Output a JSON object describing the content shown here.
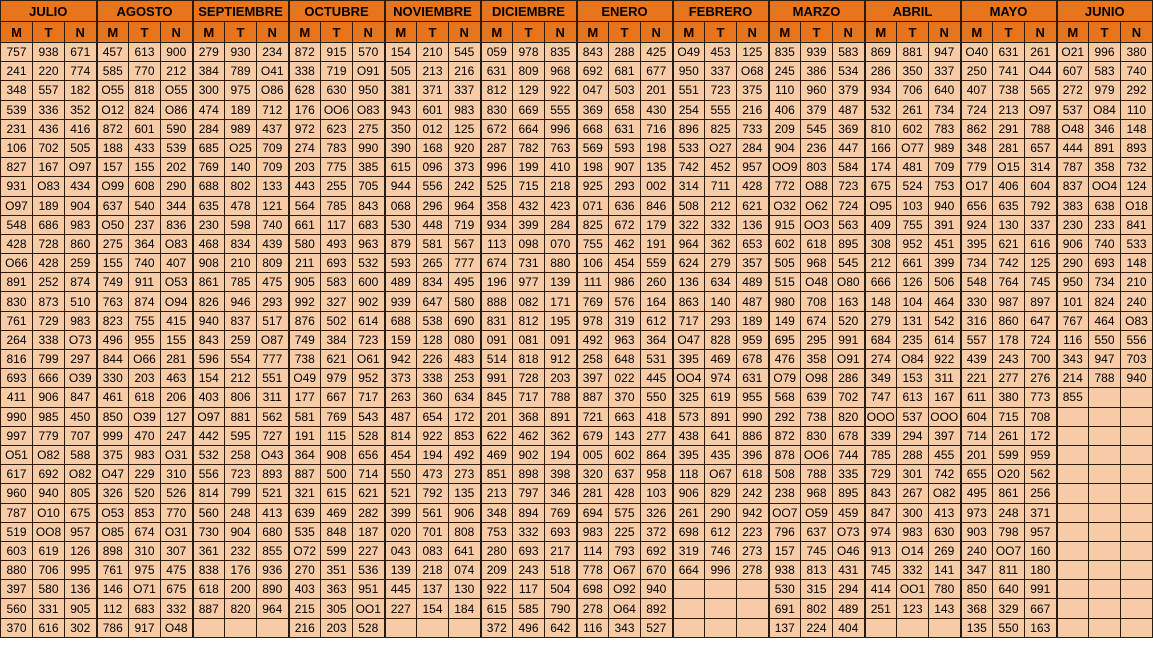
{
  "months": [
    "JULIO",
    "AGOSTO",
    "SEPTIEMBRE",
    "OCTUBRE",
    "NOVIEMBRE",
    "DICIEMBRE",
    "ENERO",
    "FEBRERO",
    "MARZO",
    "ABRIL",
    "MAYO",
    "JUNIO"
  ],
  "subheaders": [
    "M",
    "T",
    "N"
  ],
  "rows": [
    [
      "757",
      "938",
      "671",
      "457",
      "613",
      "900",
      "279",
      "930",
      "234",
      "872",
      "915",
      "570",
      "154",
      "210",
      "545",
      "059",
      "978",
      "835",
      "843",
      "288",
      "425",
      "O49",
      "453",
      "125",
      "835",
      "939",
      "583",
      "869",
      "881",
      "947",
      "O40",
      "631",
      "261",
      "O21",
      "996",
      "380"
    ],
    [
      "241",
      "220",
      "774",
      "585",
      "770",
      "212",
      "384",
      "789",
      "O41",
      "338",
      "719",
      "O91",
      "505",
      "213",
      "216",
      "631",
      "809",
      "968",
      "692",
      "681",
      "677",
      "950",
      "337",
      "O68",
      "245",
      "386",
      "534",
      "286",
      "350",
      "337",
      "250",
      "741",
      "O44",
      "607",
      "583",
      "740"
    ],
    [
      "348",
      "557",
      "182",
      "O55",
      "818",
      "O55",
      "300",
      "975",
      "O86",
      "628",
      "630",
      "950",
      "381",
      "371",
      "337",
      "812",
      "129",
      "922",
      "047",
      "503",
      "201",
      "551",
      "723",
      "375",
      "110",
      "960",
      "379",
      "934",
      "706",
      "640",
      "407",
      "738",
      "565",
      "272",
      "979",
      "292"
    ],
    [
      "539",
      "336",
      "352",
      "O12",
      "824",
      "O86",
      "474",
      "189",
      "712",
      "176",
      "OO6",
      "O83",
      "943",
      "601",
      "983",
      "830",
      "669",
      "555",
      "369",
      "658",
      "430",
      "254",
      "555",
      "216",
      "406",
      "379",
      "487",
      "532",
      "261",
      "734",
      "724",
      "213",
      "O97",
      "537",
      "O84",
      "110"
    ],
    [
      "231",
      "436",
      "416",
      "872",
      "601",
      "590",
      "284",
      "989",
      "437",
      "972",
      "623",
      "275",
      "350",
      "012",
      "125",
      "672",
      "664",
      "996",
      "668",
      "631",
      "716",
      "896",
      "825",
      "733",
      "209",
      "545",
      "369",
      "810",
      "602",
      "783",
      "862",
      "291",
      "788",
      "O48",
      "346",
      "148"
    ],
    [
      "106",
      "702",
      "505",
      "188",
      "433",
      "539",
      "685",
      "O25",
      "709",
      "274",
      "783",
      "990",
      "390",
      "168",
      "920",
      "287",
      "782",
      "763",
      "569",
      "593",
      "198",
      "533",
      "O27",
      "284",
      "904",
      "236",
      "447",
      "166",
      "O77",
      "989",
      "348",
      "281",
      "657",
      "444",
      "891",
      "893"
    ],
    [
      "827",
      "167",
      "O97",
      "157",
      "155",
      "202",
      "769",
      "140",
      "709",
      "203",
      "775",
      "385",
      "615",
      "096",
      "373",
      "996",
      "199",
      "410",
      "198",
      "907",
      "135",
      "742",
      "452",
      "957",
      "OO9",
      "803",
      "584",
      "174",
      "481",
      "709",
      "779",
      "O15",
      "314",
      "787",
      "358",
      "732"
    ],
    [
      "931",
      "O83",
      "434",
      "O99",
      "608",
      "290",
      "688",
      "802",
      "133",
      "443",
      "255",
      "705",
      "944",
      "556",
      "242",
      "525",
      "715",
      "218",
      "925",
      "293",
      "002",
      "314",
      "711",
      "428",
      "772",
      "O88",
      "723",
      "675",
      "524",
      "753",
      "O17",
      "406",
      "604",
      "837",
      "OO4",
      "124"
    ],
    [
      "O97",
      "189",
      "904",
      "637",
      "540",
      "344",
      "635",
      "478",
      "121",
      "564",
      "785",
      "843",
      "068",
      "296",
      "964",
      "358",
      "432",
      "423",
      "071",
      "636",
      "846",
      "508",
      "212",
      "621",
      "O32",
      "O62",
      "724",
      "O95",
      "103",
      "940",
      "656",
      "635",
      "792",
      "383",
      "638",
      "O18"
    ],
    [
      "548",
      "686",
      "983",
      "O50",
      "237",
      "836",
      "230",
      "598",
      "740",
      "661",
      "117",
      "683",
      "530",
      "448",
      "719",
      "934",
      "399",
      "284",
      "825",
      "672",
      "179",
      "322",
      "332",
      "136",
      "915",
      "OO3",
      "563",
      "409",
      "755",
      "391",
      "924",
      "130",
      "337",
      "230",
      "233",
      "841"
    ],
    [
      "428",
      "728",
      "860",
      "275",
      "364",
      "O83",
      "468",
      "834",
      "439",
      "580",
      "493",
      "963",
      "879",
      "581",
      "567",
      "113",
      "098",
      "070",
      "755",
      "462",
      "191",
      "964",
      "362",
      "653",
      "602",
      "618",
      "895",
      "308",
      "952",
      "451",
      "395",
      "621",
      "616",
      "906",
      "740",
      "533"
    ],
    [
      "O66",
      "428",
      "259",
      "155",
      "740",
      "407",
      "908",
      "210",
      "809",
      "211",
      "693",
      "532",
      "593",
      "265",
      "777",
      "674",
      "731",
      "880",
      "106",
      "454",
      "559",
      "624",
      "279",
      "357",
      "505",
      "968",
      "545",
      "212",
      "661",
      "399",
      "734",
      "742",
      "125",
      "290",
      "693",
      "148"
    ],
    [
      "891",
      "252",
      "874",
      "749",
      "911",
      "O53",
      "861",
      "785",
      "475",
      "905",
      "583",
      "600",
      "489",
      "834",
      "495",
      "196",
      "977",
      "139",
      "111",
      "986",
      "260",
      "136",
      "634",
      "489",
      "515",
      "O48",
      "O80",
      "666",
      "126",
      "506",
      "548",
      "764",
      "745",
      "950",
      "734",
      "210"
    ],
    [
      "830",
      "873",
      "510",
      "763",
      "874",
      "O94",
      "826",
      "946",
      "293",
      "992",
      "327",
      "902",
      "939",
      "647",
      "580",
      "888",
      "082",
      "171",
      "769",
      "576",
      "164",
      "863",
      "140",
      "487",
      "980",
      "708",
      "163",
      "148",
      "104",
      "464",
      "330",
      "987",
      "897",
      "101",
      "824",
      "240"
    ],
    [
      "761",
      "729",
      "983",
      "823",
      "755",
      "415",
      "940",
      "837",
      "517",
      "876",
      "502",
      "614",
      "688",
      "538",
      "690",
      "831",
      "812",
      "195",
      "978",
      "319",
      "612",
      "717",
      "293",
      "189",
      "149",
      "674",
      "520",
      "279",
      "131",
      "542",
      "316",
      "860",
      "647",
      "767",
      "464",
      "O83"
    ],
    [
      "264",
      "338",
      "O73",
      "496",
      "955",
      "155",
      "843",
      "259",
      "O87",
      "749",
      "384",
      "723",
      "159",
      "128",
      "080",
      "091",
      "081",
      "091",
      "492",
      "963",
      "364",
      "O47",
      "828",
      "959",
      "695",
      "295",
      "991",
      "684",
      "235",
      "614",
      "557",
      "178",
      "724",
      "116",
      "550",
      "556"
    ],
    [
      "816",
      "799",
      "297",
      "844",
      "O66",
      "281",
      "596",
      "554",
      "777",
      "738",
      "621",
      "O61",
      "942",
      "226",
      "483",
      "514",
      "818",
      "912",
      "258",
      "648",
      "531",
      "395",
      "469",
      "678",
      "476",
      "358",
      "O91",
      "274",
      "O84",
      "922",
      "439",
      "243",
      "700",
      "343",
      "947",
      "703"
    ],
    [
      "693",
      "666",
      "O39",
      "330",
      "203",
      "463",
      "154",
      "212",
      "551",
      "O49",
      "979",
      "952",
      "373",
      "338",
      "253",
      "991",
      "728",
      "203",
      "397",
      "022",
      "445",
      "OO4",
      "974",
      "631",
      "O79",
      "O98",
      "286",
      "349",
      "153",
      "311",
      "221",
      "277",
      "276",
      "214",
      "788",
      "940"
    ],
    [
      "411",
      "906",
      "847",
      "461",
      "618",
      "206",
      "403",
      "806",
      "311",
      "177",
      "667",
      "717",
      "263",
      "360",
      "634",
      "845",
      "717",
      "788",
      "887",
      "370",
      "550",
      "325",
      "619",
      "955",
      "568",
      "639",
      "702",
      "747",
      "613",
      "167",
      "611",
      "380",
      "773",
      "855",
      "",
      ""
    ],
    [
      "990",
      "985",
      "450",
      "850",
      "O39",
      "127",
      "O97",
      "881",
      "562",
      "581",
      "769",
      "543",
      "487",
      "654",
      "172",
      "201",
      "368",
      "891",
      "721",
      "663",
      "418",
      "573",
      "891",
      "990",
      "292",
      "738",
      "820",
      "OOO",
      "537",
      "OOO",
      "604",
      "715",
      "708",
      "",
      "",
      ""
    ],
    [
      "997",
      "779",
      "707",
      "999",
      "470",
      "247",
      "442",
      "595",
      "727",
      "191",
      "115",
      "528",
      "814",
      "922",
      "853",
      "622",
      "462",
      "362",
      "679",
      "143",
      "277",
      "438",
      "641",
      "886",
      "872",
      "830",
      "678",
      "339",
      "294",
      "397",
      "714",
      "261",
      "172",
      "",
      "",
      ""
    ],
    [
      "O51",
      "O82",
      "588",
      "375",
      "983",
      "O31",
      "532",
      "258",
      "O43",
      "364",
      "908",
      "656",
      "454",
      "194",
      "492",
      "469",
      "902",
      "194",
      "005",
      "602",
      "864",
      "395",
      "435",
      "396",
      "878",
      "OO6",
      "744",
      "785",
      "288",
      "455",
      "201",
      "599",
      "959",
      "",
      "",
      ""
    ],
    [
      "617",
      "692",
      "O82",
      "O47",
      "229",
      "310",
      "556",
      "723",
      "893",
      "887",
      "500",
      "714",
      "550",
      "473",
      "273",
      "851",
      "898",
      "398",
      "320",
      "637",
      "958",
      "118",
      "O67",
      "618",
      "508",
      "788",
      "335",
      "729",
      "301",
      "742",
      "655",
      "O20",
      "562",
      "",
      "",
      ""
    ],
    [
      "960",
      "940",
      "805",
      "326",
      "520",
      "526",
      "814",
      "799",
      "521",
      "321",
      "615",
      "621",
      "521",
      "792",
      "135",
      "213",
      "797",
      "346",
      "281",
      "428",
      "103",
      "906",
      "829",
      "242",
      "238",
      "968",
      "895",
      "843",
      "267",
      "O82",
      "495",
      "861",
      "256",
      "",
      "",
      ""
    ],
    [
      "787",
      "O10",
      "675",
      "O53",
      "853",
      "770",
      "560",
      "248",
      "413",
      "639",
      "469",
      "282",
      "399",
      "561",
      "906",
      "348",
      "894",
      "769",
      "694",
      "575",
      "326",
      "261",
      "290",
      "942",
      "OO7",
      "O59",
      "459",
      "847",
      "300",
      "413",
      "973",
      "248",
      "371",
      "",
      "",
      ""
    ],
    [
      "519",
      "OO8",
      "957",
      "O85",
      "674",
      "O31",
      "730",
      "904",
      "680",
      "535",
      "848",
      "187",
      "020",
      "701",
      "808",
      "753",
      "332",
      "693",
      "983",
      "225",
      "372",
      "698",
      "612",
      "223",
      "796",
      "637",
      "O73",
      "974",
      "983",
      "630",
      "903",
      "798",
      "957",
      "",
      "",
      ""
    ],
    [
      "603",
      "619",
      "126",
      "898",
      "310",
      "307",
      "361",
      "232",
      "855",
      "O72",
      "599",
      "227",
      "043",
      "083",
      "641",
      "280",
      "693",
      "217",
      "114",
      "793",
      "692",
      "319",
      "746",
      "273",
      "157",
      "745",
      "O46",
      "913",
      "O14",
      "269",
      "240",
      "OO7",
      "160",
      "",
      "",
      ""
    ],
    [
      "880",
      "706",
      "995",
      "761",
      "975",
      "475",
      "838",
      "176",
      "936",
      "270",
      "351",
      "536",
      "139",
      "218",
      "074",
      "209",
      "243",
      "518",
      "778",
      "O67",
      "670",
      "664",
      "996",
      "278",
      "938",
      "813",
      "431",
      "745",
      "332",
      "141",
      "347",
      "811",
      "180",
      "",
      "",
      ""
    ],
    [
      "397",
      "580",
      "136",
      "146",
      "O71",
      "675",
      "618",
      "200",
      "890",
      "403",
      "363",
      "951",
      "445",
      "137",
      "130",
      "922",
      "117",
      "504",
      "698",
      "O92",
      "940",
      "",
      "",
      "",
      "530",
      "315",
      "294",
      "414",
      "OO1",
      "780",
      "850",
      "640",
      "991",
      "",
      "",
      ""
    ],
    [
      "560",
      "331",
      "905",
      "112",
      "683",
      "332",
      "887",
      "820",
      "964",
      "215",
      "305",
      "OO1",
      "227",
      "154",
      "184",
      "615",
      "585",
      "790",
      "278",
      "O64",
      "892",
      "",
      "",
      "",
      "691",
      "802",
      "489",
      "251",
      "123",
      "143",
      "368",
      "329",
      "667",
      "",
      "",
      ""
    ],
    [
      "370",
      "616",
      "302",
      "786",
      "917",
      "O48",
      "",
      "",
      "",
      "216",
      "203",
      "528",
      "",
      "",
      "",
      "372",
      "496",
      "642",
      "116",
      "343",
      "527",
      "",
      "",
      "",
      "137",
      "224",
      "404",
      "",
      "",
      "",
      "135",
      "550",
      "163",
      "",
      "",
      ""
    ]
  ]
}
